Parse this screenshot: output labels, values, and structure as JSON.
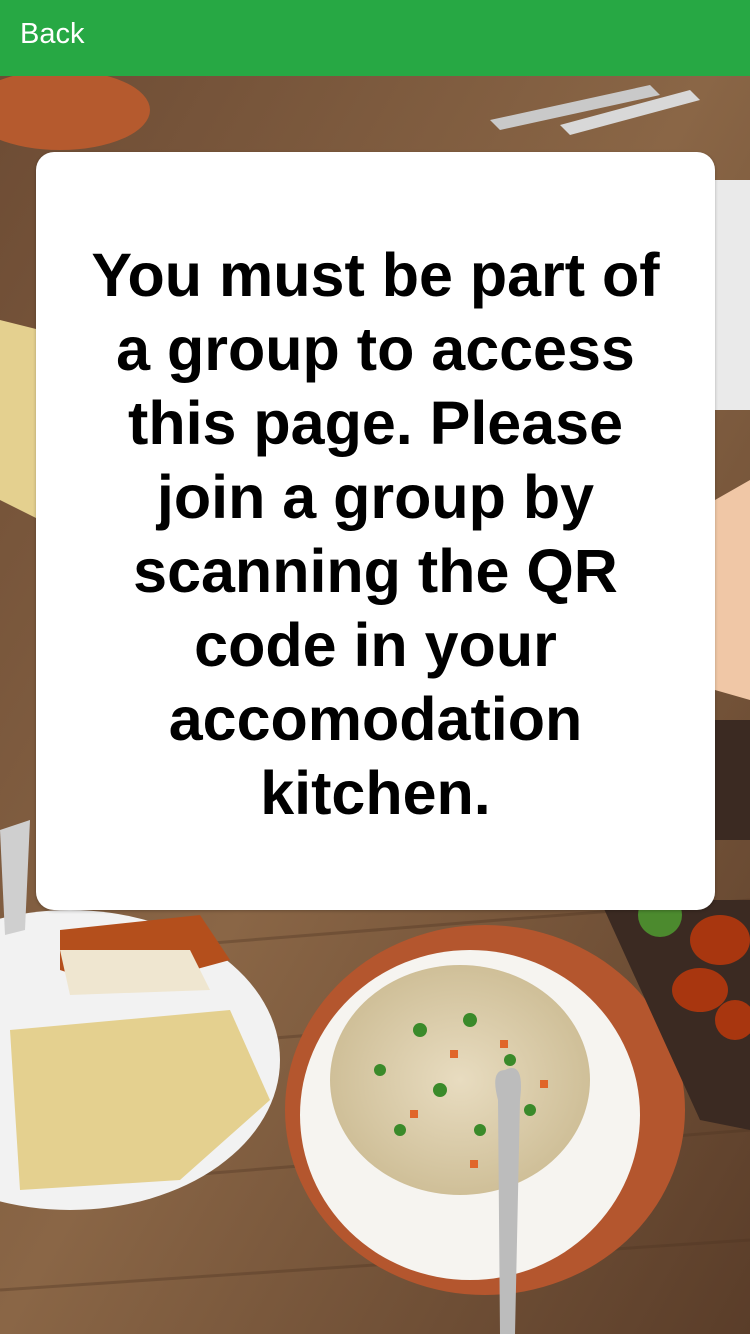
{
  "header": {
    "back_label": "Back",
    "background_color": "#27a844"
  },
  "notice": {
    "message": "You must be part of a group to access this page. Please join a group by scanning the QR code in your accomodation kitchen."
  },
  "background": {
    "description_icon": "food-table-photo"
  }
}
